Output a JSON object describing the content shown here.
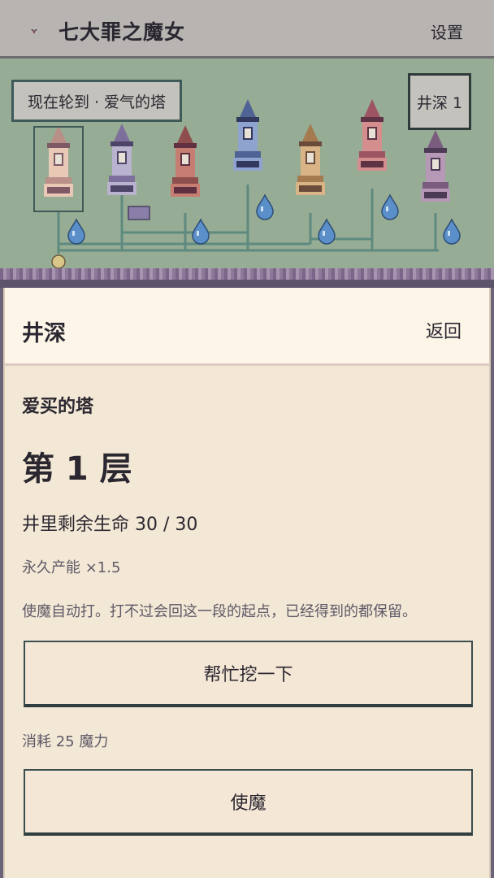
{
  "header": {
    "app_title": "七大罪之魔女",
    "settings_label": "设置",
    "logo_icon": "bat-icon"
  },
  "scene": {
    "turn_text": "现在轮到 · 爱气的塔",
    "depth_badge": "井深 1",
    "towers": [
      {
        "name": "tower-1",
        "palette": [
          "#e9c9b6",
          "#b98f88",
          "#7e5a66"
        ],
        "selected": true
      },
      {
        "name": "tower-2",
        "palette": [
          "#b9b3cf",
          "#7d6f9c",
          "#4e4468"
        ],
        "selected": false
      },
      {
        "name": "tower-3",
        "palette": [
          "#c77e72",
          "#8f4e4e",
          "#5e3040"
        ],
        "selected": false
      },
      {
        "name": "tower-4",
        "palette": [
          "#8fa3cf",
          "#4f6494",
          "#33385e"
        ],
        "selected": false
      },
      {
        "name": "tower-5",
        "palette": [
          "#d9b486",
          "#a47a4e",
          "#6b4c3a"
        ],
        "selected": false
      },
      {
        "name": "tower-6",
        "palette": [
          "#d48e8e",
          "#9e5563",
          "#5e3344"
        ],
        "selected": false
      },
      {
        "name": "tower-7",
        "palette": [
          "#b699b6",
          "#7a5c7e",
          "#4d3a55"
        ],
        "selected": false
      }
    ],
    "water_drop_icon": "water-drop-icon",
    "colors": {
      "pipe": "#5e8a80",
      "ground": "#97ac94",
      "drop": "#5b8fc9"
    }
  },
  "panel": {
    "title": "井深",
    "back_label": "返回",
    "tower_name": "爱买的塔",
    "floor_label": "第 1 层",
    "well_life": "井里剩余生命 30 / 30",
    "permanent_bonus": "永久产能 ×1.5",
    "familiar_desc": "使魔自动打。打不过会回这一段的起点，已经得到的都保留。",
    "dig_button": "帮忙挖一下",
    "cost_label": "消耗 25 魔力",
    "familiar_button": "使魔"
  }
}
